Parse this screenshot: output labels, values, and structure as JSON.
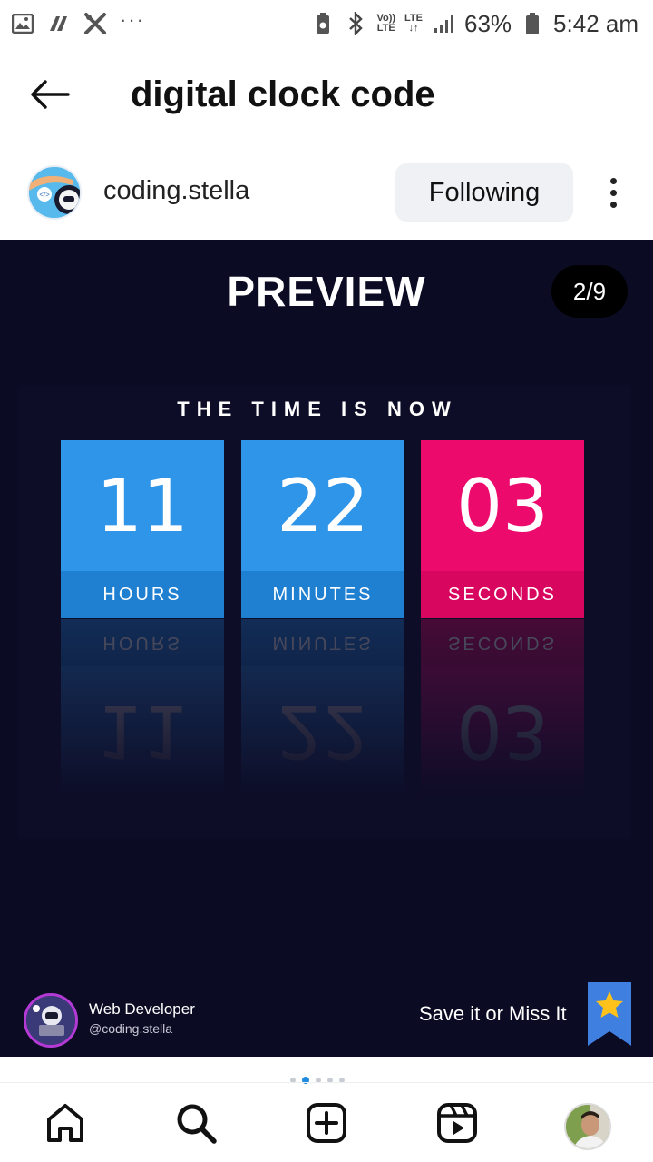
{
  "status_bar": {
    "battery": "63%",
    "time": "5:42 am",
    "network_top": "Vo))",
    "network_bottom": "LTE",
    "lte_top": "LTE",
    "lte_bottom": "↓↑",
    "more": "···"
  },
  "header": {
    "title": "digital clock code"
  },
  "profile": {
    "username": "coding.stella",
    "follow_label": "Following"
  },
  "post": {
    "title": "PREVIEW",
    "page_indicator": "2/9",
    "clock_heading": "THE TIME IS NOW",
    "tiles": [
      {
        "value": "11",
        "label": "HOURS"
      },
      {
        "value": "22",
        "label": "MINUTES"
      },
      {
        "value": "03",
        "label": "SECONDS"
      }
    ],
    "footer": {
      "role": "Web Developer",
      "handle": "@coding.stella",
      "cta": "Save it or Miss It"
    },
    "colors": {
      "background": "#0b0b23",
      "tile_blue": "#2f95e8",
      "tile_pink": "#ec0a6c"
    }
  },
  "carousel": {
    "count": 5,
    "active_index": 1
  },
  "bottom_nav": {
    "items": [
      "home-icon",
      "search-icon",
      "create-icon",
      "reels-icon",
      "profile-avatar"
    ]
  }
}
